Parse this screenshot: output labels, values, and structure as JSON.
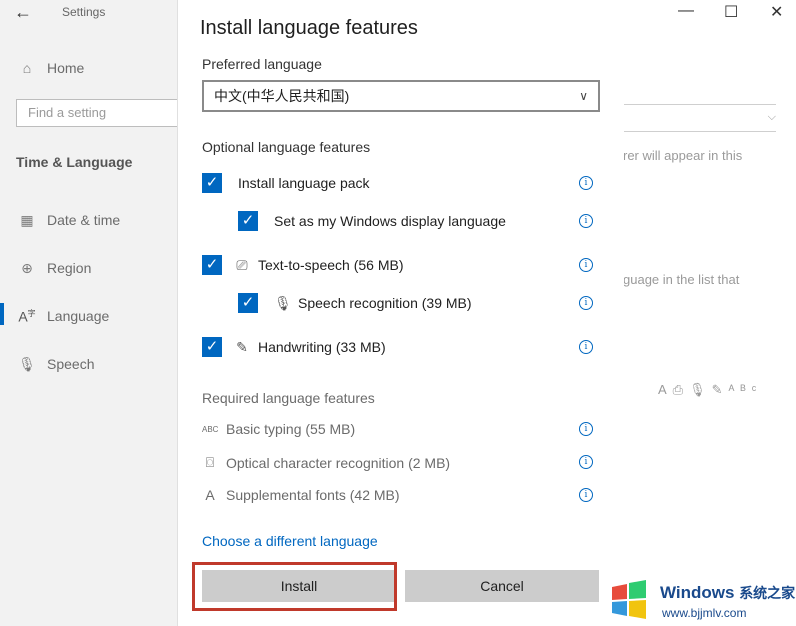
{
  "settings": {
    "app_title": "Settings",
    "back_icon": "←",
    "nav": {
      "home": "Home",
      "date_time": "Date & time",
      "region": "Region",
      "language": "Language",
      "speech": "Speech"
    },
    "search_placeholder": "Find a setting",
    "section": "Time & Language",
    "window_controls": {
      "minimize": "—",
      "maximize": "☐",
      "close": "✕"
    },
    "bg_text_1": "rer will appear in this",
    "bg_text_2": "guage in the list that"
  },
  "dialog": {
    "title": "Install language features",
    "preferred_label": "Preferred language",
    "preferred_value": "中文(中华人民共和国)",
    "optional_label": "Optional language features",
    "optional": [
      {
        "label": "Install language pack",
        "checked": true
      },
      {
        "label": "Set as my Windows display language",
        "checked": true
      },
      {
        "label": "Text-to-speech (56 MB)",
        "checked": true
      },
      {
        "label": "Speech recognition (39 MB)",
        "checked": true
      },
      {
        "label": "Handwriting (33 MB)",
        "checked": true
      }
    ],
    "required_label": "Required language features",
    "required": [
      {
        "label": "Basic typing (55 MB)",
        "icon": "ABC"
      },
      {
        "label": "Optical character recognition (2 MB)",
        "icon": "⌼"
      },
      {
        "label": "Supplemental fonts (42 MB)",
        "icon": "A"
      }
    ],
    "link": "Choose a different language",
    "install": "Install",
    "cancel": "Cancel",
    "info_glyph": "i",
    "check_glyph": "✓"
  },
  "watermark": {
    "brand": "Windows",
    "brand_cn": "系统之家",
    "url": "www.bjjmlv.com"
  },
  "colors": {
    "accent": "#0067c0",
    "highlight": "#c0392b"
  }
}
